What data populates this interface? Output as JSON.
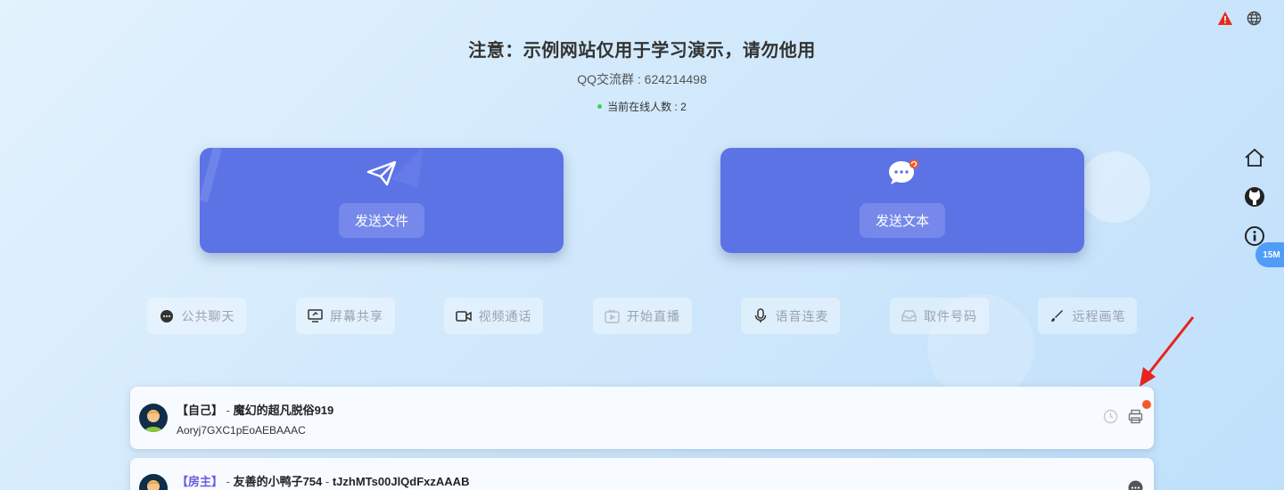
{
  "header": {
    "title": "注意：示例网站仅用于学习演示，请勿他用",
    "qq": "QQ交流群 : 624214498",
    "online": "当前在线人数 : 2"
  },
  "cards": {
    "send_file": "发送文件",
    "send_text": "发送文本"
  },
  "tools": [
    {
      "label": "公共聊天",
      "icon": "chat-icon"
    },
    {
      "label": "屏幕共享",
      "icon": "screen-share-icon"
    },
    {
      "label": "视频通话",
      "icon": "video-icon"
    },
    {
      "label": "开始直播",
      "icon": "live-tv-icon"
    },
    {
      "label": "语音连麦",
      "icon": "mic-icon"
    },
    {
      "label": "取件号码",
      "icon": "inbox-icon"
    },
    {
      "label": "远程画笔",
      "icon": "brush-icon"
    }
  ],
  "side": {
    "badge": "15M"
  },
  "users": [
    {
      "role": "【自己】",
      "sep": " - ",
      "name": "魔幻的超凡脱俗919",
      "id": "Aoryj7GXC1pEoAEBAAAC"
    },
    {
      "role": "【房主】",
      "sep": " - ",
      "name": "友善的小鸭子754",
      "sep2": " - ",
      "id": "tJzhMTs00JlQdFxzAAAB"
    }
  ],
  "colors": {
    "card": "#5c73e6",
    "online_dot": "#3ad15b",
    "host_role": "#6a5ae0",
    "arrow": "#e8231c"
  }
}
